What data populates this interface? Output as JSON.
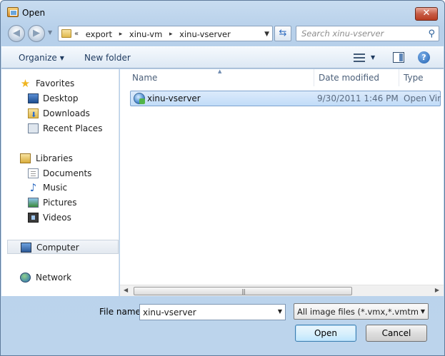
{
  "window": {
    "title": "Open",
    "close_label": "✕"
  },
  "nav": {
    "back_icon": "back-arrow",
    "forward_icon": "forward-arrow"
  },
  "address": {
    "overflow": "«",
    "crumbs": [
      "export",
      "xinu-vm",
      "xinu-vserver"
    ],
    "separator": "▸"
  },
  "search": {
    "placeholder": "Search xinu-vserver"
  },
  "toolbar": {
    "organize_label": "Organize",
    "new_folder_label": "New folder"
  },
  "navpane": {
    "favorites": {
      "label": "Favorites",
      "items": [
        "Desktop",
        "Downloads",
        "Recent Places"
      ]
    },
    "libraries": {
      "label": "Libraries",
      "items": [
        "Documents",
        "Music",
        "Pictures",
        "Videos"
      ]
    },
    "computer": "Computer",
    "network": "Network"
  },
  "columns": {
    "name": "Name",
    "date": "Date modified",
    "type": "Type"
  },
  "files": [
    {
      "name": "xinu-vserver",
      "date": "9/30/2011 1:46 PM",
      "type": "Open Virt"
    }
  ],
  "bottom": {
    "filename_label": "File name:",
    "filename_value": "xinu-vserver",
    "filter_value": "All image files (*.vmx,*.vmtm,*.",
    "open_label": "Open",
    "cancel_label": "Cancel"
  },
  "colors": {
    "accent": "#3c7fb1",
    "selection": "#c1dcf8",
    "frame": "#bcd4ec"
  }
}
